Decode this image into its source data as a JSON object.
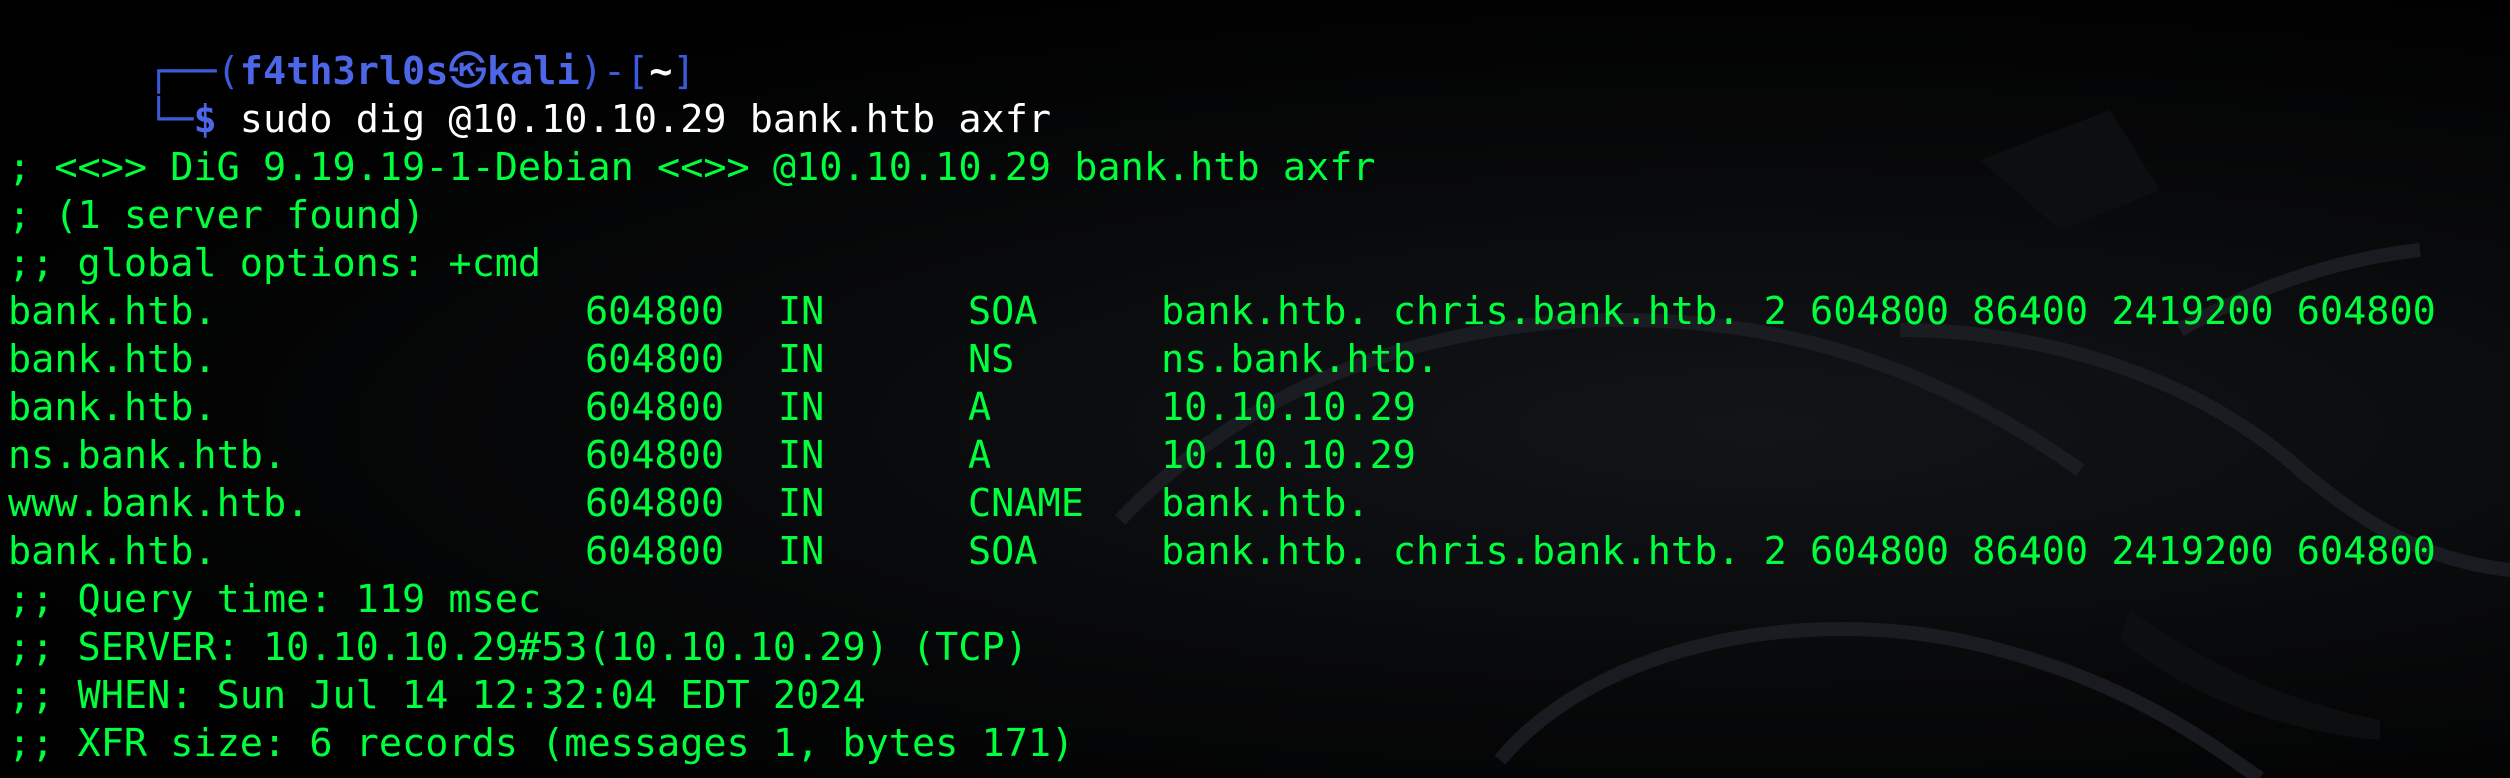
{
  "prompt": {
    "frame_top_left": "┌──(",
    "user": "f4th3rl0s",
    "skull": "㉿",
    "host": "kali",
    "frame_mid": ")-[",
    "cwd": "~",
    "frame_close": "]",
    "frame_bottom": "└─",
    "dollar": "$",
    "command": " sudo dig @10.10.10.29 bank.htb axfr"
  },
  "output": {
    "header1": "; <<>> DiG 9.19.19-1-Debian <<>> @10.10.10.29 bank.htb axfr",
    "header2": "; (1 server found)",
    "header3": ";; global options: +cmd",
    "records": [
      {
        "name": "bank.htb.",
        "ttl": "604800",
        "class": "IN",
        "type": "SOA",
        "data": "bank.htb. chris.bank.htb. 2 604800 86400 2419200 604800"
      },
      {
        "name": "bank.htb.",
        "ttl": "604800",
        "class": "IN",
        "type": "NS",
        "data": "ns.bank.htb."
      },
      {
        "name": "bank.htb.",
        "ttl": "604800",
        "class": "IN",
        "type": "A",
        "data": "10.10.10.29"
      },
      {
        "name": "ns.bank.htb.",
        "ttl": "604800",
        "class": "IN",
        "type": "A",
        "data": "10.10.10.29"
      },
      {
        "name": "www.bank.htb.",
        "ttl": "604800",
        "class": "IN",
        "type": "CNAME",
        "data": "bank.htb."
      },
      {
        "name": "bank.htb.",
        "ttl": "604800",
        "class": "IN",
        "type": "SOA",
        "data": "bank.htb. chris.bank.htb. 2 604800 86400 2419200 604800"
      }
    ],
    "footer1": ";; Query time: 119 msec",
    "footer2": ";; SERVER: 10.10.10.29#53(10.10.10.29) (TCP)",
    "footer3": ";; WHEN: Sun Jul 14 12:32:04 EDT 2024",
    "footer4": ";; XFR size: 6 records (messages 1, bytes 171)"
  },
  "colors": {
    "background": "#000000",
    "output_text": "#00ff3c",
    "prompt_accent": "#4c66e8",
    "command_text": "#ffffff"
  }
}
